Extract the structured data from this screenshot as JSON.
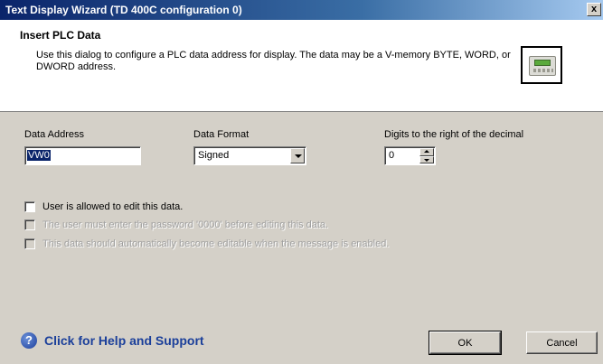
{
  "window": {
    "title": "Text Display Wizard (TD 400C configuration 0)",
    "close_glyph": "x"
  },
  "header": {
    "title": "Insert PLC Data",
    "description": "Use this dialog to configure a PLC data address for display. The data may be a V-memory BYTE, WORD, or DWORD address.",
    "icon": "td400c-device-icon"
  },
  "fields": {
    "data_address": {
      "label": "Data Address",
      "value": "VW0"
    },
    "data_format": {
      "label": "Data Format",
      "value": "Signed"
    },
    "digits": {
      "label": "Digits to the right of the decimal",
      "value": "0"
    }
  },
  "options": [
    {
      "label": "User is allowed to edit this data.",
      "checked": false,
      "enabled": true
    },
    {
      "label": "The user must enter the password '0000' before editing this data.",
      "checked": false,
      "enabled": false
    },
    {
      "label": "This data should automatically become editable when the message is enabled.",
      "checked": false,
      "enabled": false
    }
  ],
  "help": {
    "label": "Click for Help and Support",
    "icon": "help-question-icon",
    "color": "#1b3f9a"
  },
  "buttons": {
    "ok": "OK",
    "cancel": "Cancel"
  },
  "colors": {
    "dialog_bg": "#d4d0c8",
    "titlebar": "#0a246a",
    "selection": "#0a246a"
  }
}
